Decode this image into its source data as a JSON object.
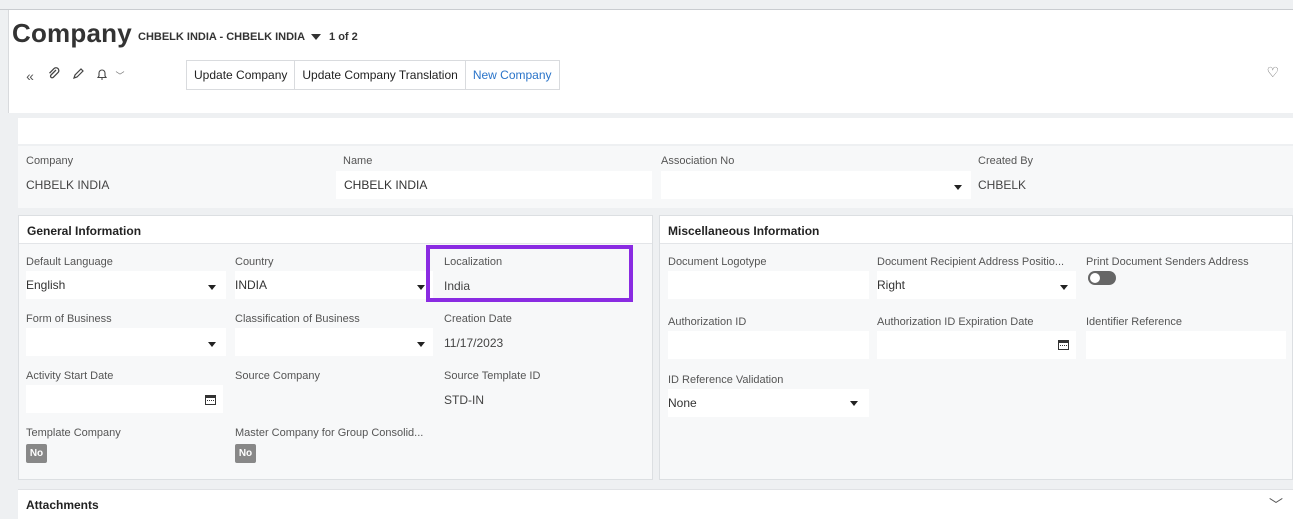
{
  "header": {
    "title": "Company",
    "record": "CHBELK INDIA - CHBELK INDIA",
    "pager": "1 of 2",
    "buttons": [
      "Update Company",
      "Update Company Translation",
      "New Company"
    ]
  },
  "icons": [
    "double-chevron-left-icon",
    "paperclip-icon",
    "pencil-icon",
    "bell-icon",
    "chevron-down-icon",
    "heart-icon",
    "calendar-icon"
  ],
  "key_fields": {
    "company": {
      "label": "Company",
      "value": "CHBELK INDIA"
    },
    "name": {
      "label": "Name",
      "value": "CHBELK INDIA"
    },
    "association_no": {
      "label": "Association No",
      "value": ""
    },
    "created_by": {
      "label": "Created By",
      "value": "CHBELK"
    }
  },
  "general": {
    "title": "General Information",
    "default_language": {
      "label": "Default Language",
      "value": "English"
    },
    "country": {
      "label": "Country",
      "value": "INDIA"
    },
    "localization": {
      "label": "Localization",
      "value": "India"
    },
    "form_of_business": {
      "label": "Form of Business",
      "value": ""
    },
    "classification": {
      "label": "Classification of Business",
      "value": ""
    },
    "creation_date": {
      "label": "Creation Date",
      "value": "11/17/2023"
    },
    "activity_start": {
      "label": "Activity Start Date",
      "value": ""
    },
    "source_company": {
      "label": "Source Company",
      "value": ""
    },
    "source_template": {
      "label": "Source Template ID",
      "value": "STD-IN"
    },
    "template_company": {
      "label": "Template Company",
      "value": "No"
    },
    "master_company": {
      "label": "Master Company for Group Consolid...",
      "value": "No"
    }
  },
  "misc": {
    "title": "Miscellaneous Information",
    "logotype": {
      "label": "Document Logotype",
      "value": ""
    },
    "recipient_pos": {
      "label": "Document Recipient Address Positio...",
      "value": "Right"
    },
    "print_senders": {
      "label": "Print Document Senders Address",
      "value": false
    },
    "auth_id": {
      "label": "Authorization ID",
      "value": ""
    },
    "auth_exp": {
      "label": "Authorization ID Expiration Date",
      "value": ""
    },
    "identifier_ref": {
      "label": "Identifier Reference",
      "value": ""
    },
    "id_ref_validation": {
      "label": "ID Reference Validation",
      "value": "None"
    }
  },
  "attachments": {
    "label": "Attachments"
  },
  "colors": {
    "highlight": "#8a2be2",
    "link": "#2a74c9"
  }
}
